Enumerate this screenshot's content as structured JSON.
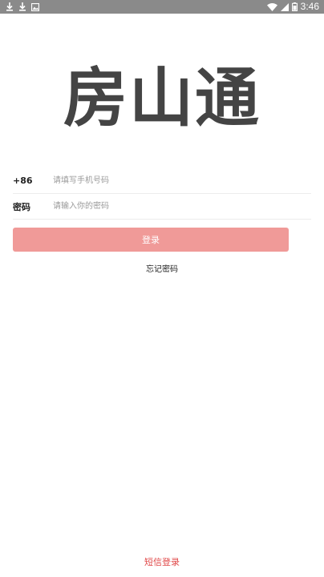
{
  "status_bar": {
    "time": "3:46",
    "left_icons": [
      "download-icon",
      "download-icon",
      "image-icon"
    ],
    "right_icons": [
      "wifi-icon",
      "signal-icon",
      "battery-icon"
    ]
  },
  "app": {
    "title": "房山通"
  },
  "form": {
    "phone_label": "+86",
    "phone_placeholder": "请填写手机号码",
    "password_label": "密码",
    "password_placeholder": "请输入你的密码"
  },
  "actions": {
    "login_label": "登录",
    "forgot_label": "忘记密码",
    "sms_login_label": "短信登录"
  },
  "colors": {
    "status_bar": "#8a8a8a",
    "login_button": "#f09a98",
    "sms_link": "#e04848"
  }
}
